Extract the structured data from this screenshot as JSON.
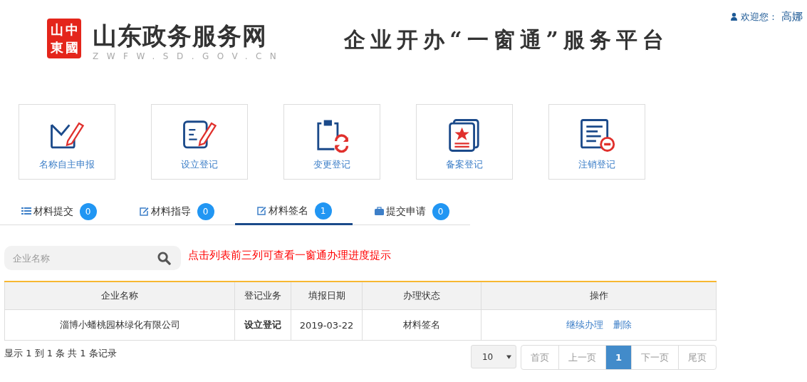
{
  "header": {
    "seal": [
      "山",
      "中",
      "東",
      "國"
    ],
    "site_name": "山东政务服务网",
    "site_domain": "ZWFW.SD.GOV.CN",
    "platform_title": "企业开办“一窗通”服务平台",
    "welcome_label": "欢迎您：",
    "user_name": "高娜"
  },
  "services": [
    {
      "kind": "name",
      "label": "名称自主申报"
    },
    {
      "kind": "setup",
      "label": "设立登记"
    },
    {
      "kind": "change",
      "label": "变更登记"
    },
    {
      "kind": "record",
      "label": "备案登记"
    },
    {
      "kind": "cancel",
      "label": "注销登记"
    }
  ],
  "tabs": [
    {
      "kind": "list",
      "label": "材料提交",
      "count": "0",
      "selected": false
    },
    {
      "kind": "edit",
      "label": "材料指导",
      "count": "0",
      "selected": false
    },
    {
      "kind": "edit",
      "label": "材料签名",
      "count": "1",
      "selected": true
    },
    {
      "kind": "case",
      "label": "提交申请",
      "count": "0",
      "selected": false
    }
  ],
  "search": {
    "placeholder": "企业名称"
  },
  "hint": "点击列表前三列可查看一窗通办理进度提示",
  "table": {
    "columns": [
      "企业名称",
      "登记业务",
      "填报日期",
      "办理状态",
      "操作"
    ],
    "rows": [
      {
        "cells": [
          "淄博小蟠桃园林绿化有限公司",
          "设立登记",
          "2019-03-22",
          "材料签名"
        ],
        "actions": [
          "继续办理",
          "删除"
        ]
      }
    ]
  },
  "summary": "显示 1 到 1 条 共 1 条记录",
  "pagination": {
    "page_size": "10",
    "buttons": [
      {
        "label": "首页",
        "selected": false
      },
      {
        "label": "上一页",
        "selected": false
      },
      {
        "label": "1",
        "selected": true
      },
      {
        "label": "下一页",
        "selected": false
      },
      {
        "label": "尾页",
        "selected": false
      }
    ]
  }
}
